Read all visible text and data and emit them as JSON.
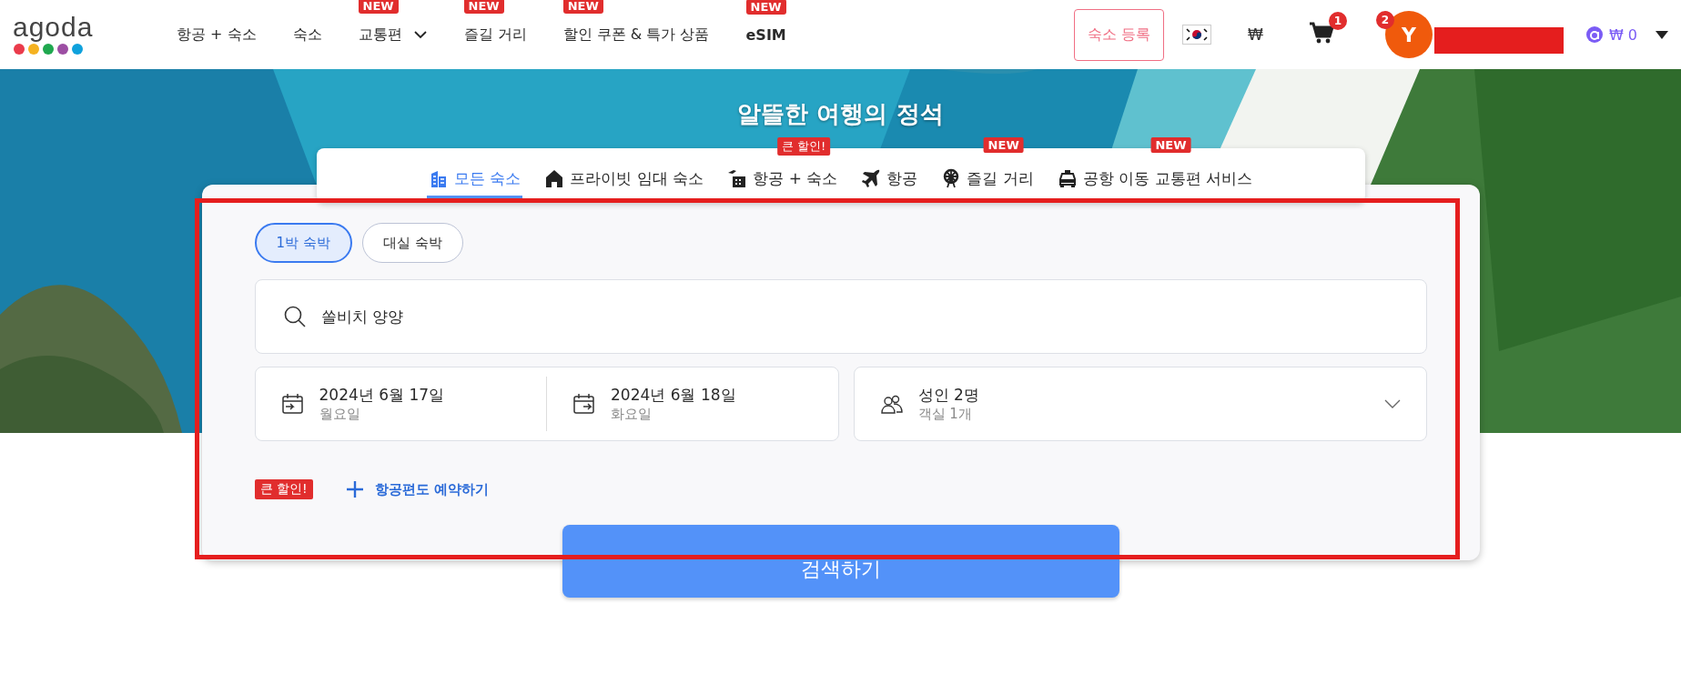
{
  "header": {
    "logo": "agoda",
    "nav": [
      {
        "label": "항공 + 숙소",
        "dropdown": false,
        "bold": false
      },
      {
        "label": "숙소",
        "dropdown": false,
        "bold": false
      },
      {
        "label": "교통편",
        "badge": "NEW",
        "dropdown": true,
        "bold": false
      },
      {
        "label": "즐길 거리",
        "badge": "NEW",
        "dropdown": false,
        "bold": false
      },
      {
        "label": "할인 쿠폰 & 특가 상품",
        "badge": "NEW",
        "dropdown": false,
        "bold": false
      },
      {
        "label": "eSIM",
        "badge": "NEW",
        "dropdown": false,
        "bold": true
      }
    ],
    "list_property": "숙소 등록",
    "currency": "₩",
    "cart_count": "1",
    "avatar": {
      "initial": "Y",
      "count": "2"
    },
    "points": "₩ 0"
  },
  "hero": {
    "title": "알뜰한 여행의 정석"
  },
  "tabs": [
    {
      "label": "모든 숙소",
      "selected": true
    },
    {
      "label": "프라이빗 임대 숙소",
      "selected": false
    },
    {
      "label": "항공 + 숙소",
      "badge": "큰 할인!",
      "selected": false
    },
    {
      "label": "항공",
      "selected": false
    },
    {
      "label": "즐길 거리",
      "badge": "NEW",
      "selected": false
    },
    {
      "label": "공항 이동 교통편 서비스",
      "badge": "NEW",
      "selected": false
    }
  ],
  "stay_types": [
    {
      "label": "1박 숙박",
      "selected": true
    },
    {
      "label": "대실 숙박",
      "selected": false
    }
  ],
  "search": {
    "value": "쏠비치 양양"
  },
  "check_in": {
    "date": "2024년 6월 17일",
    "weekday": "월요일"
  },
  "check_out": {
    "date": "2024년 6월 18일",
    "weekday": "화요일"
  },
  "guests": {
    "adults": "성인 2명",
    "rooms": "객실 1개"
  },
  "add_flight": {
    "badge": "큰 할인!",
    "label": "항공편도 예약하기"
  },
  "search_button": "검색하기"
}
